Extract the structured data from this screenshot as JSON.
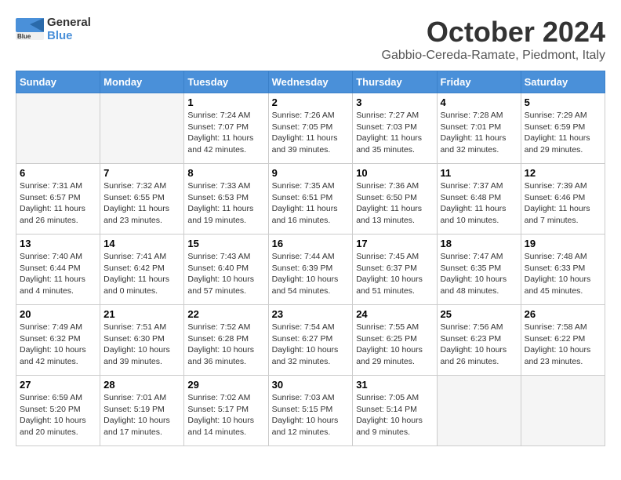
{
  "header": {
    "logo_general": "General",
    "logo_blue": "Blue",
    "month": "October 2024",
    "location": "Gabbio-Cereda-Ramate, Piedmont, Italy"
  },
  "weekdays": [
    "Sunday",
    "Monday",
    "Tuesday",
    "Wednesday",
    "Thursday",
    "Friday",
    "Saturday"
  ],
  "weeks": [
    [
      {
        "day": null
      },
      {
        "day": null
      },
      {
        "day": "1",
        "sunrise": "Sunrise: 7:24 AM",
        "sunset": "Sunset: 7:07 PM",
        "daylight": "Daylight: 11 hours and 42 minutes."
      },
      {
        "day": "2",
        "sunrise": "Sunrise: 7:26 AM",
        "sunset": "Sunset: 7:05 PM",
        "daylight": "Daylight: 11 hours and 39 minutes."
      },
      {
        "day": "3",
        "sunrise": "Sunrise: 7:27 AM",
        "sunset": "Sunset: 7:03 PM",
        "daylight": "Daylight: 11 hours and 35 minutes."
      },
      {
        "day": "4",
        "sunrise": "Sunrise: 7:28 AM",
        "sunset": "Sunset: 7:01 PM",
        "daylight": "Daylight: 11 hours and 32 minutes."
      },
      {
        "day": "5",
        "sunrise": "Sunrise: 7:29 AM",
        "sunset": "Sunset: 6:59 PM",
        "daylight": "Daylight: 11 hours and 29 minutes."
      }
    ],
    [
      {
        "day": "6",
        "sunrise": "Sunrise: 7:31 AM",
        "sunset": "Sunset: 6:57 PM",
        "daylight": "Daylight: 11 hours and 26 minutes."
      },
      {
        "day": "7",
        "sunrise": "Sunrise: 7:32 AM",
        "sunset": "Sunset: 6:55 PM",
        "daylight": "Daylight: 11 hours and 23 minutes."
      },
      {
        "day": "8",
        "sunrise": "Sunrise: 7:33 AM",
        "sunset": "Sunset: 6:53 PM",
        "daylight": "Daylight: 11 hours and 19 minutes."
      },
      {
        "day": "9",
        "sunrise": "Sunrise: 7:35 AM",
        "sunset": "Sunset: 6:51 PM",
        "daylight": "Daylight: 11 hours and 16 minutes."
      },
      {
        "day": "10",
        "sunrise": "Sunrise: 7:36 AM",
        "sunset": "Sunset: 6:50 PM",
        "daylight": "Daylight: 11 hours and 13 minutes."
      },
      {
        "day": "11",
        "sunrise": "Sunrise: 7:37 AM",
        "sunset": "Sunset: 6:48 PM",
        "daylight": "Daylight: 11 hours and 10 minutes."
      },
      {
        "day": "12",
        "sunrise": "Sunrise: 7:39 AM",
        "sunset": "Sunset: 6:46 PM",
        "daylight": "Daylight: 11 hours and 7 minutes."
      }
    ],
    [
      {
        "day": "13",
        "sunrise": "Sunrise: 7:40 AM",
        "sunset": "Sunset: 6:44 PM",
        "daylight": "Daylight: 11 hours and 4 minutes."
      },
      {
        "day": "14",
        "sunrise": "Sunrise: 7:41 AM",
        "sunset": "Sunset: 6:42 PM",
        "daylight": "Daylight: 11 hours and 0 minutes."
      },
      {
        "day": "15",
        "sunrise": "Sunrise: 7:43 AM",
        "sunset": "Sunset: 6:40 PM",
        "daylight": "Daylight: 10 hours and 57 minutes."
      },
      {
        "day": "16",
        "sunrise": "Sunrise: 7:44 AM",
        "sunset": "Sunset: 6:39 PM",
        "daylight": "Daylight: 10 hours and 54 minutes."
      },
      {
        "day": "17",
        "sunrise": "Sunrise: 7:45 AM",
        "sunset": "Sunset: 6:37 PM",
        "daylight": "Daylight: 10 hours and 51 minutes."
      },
      {
        "day": "18",
        "sunrise": "Sunrise: 7:47 AM",
        "sunset": "Sunset: 6:35 PM",
        "daylight": "Daylight: 10 hours and 48 minutes."
      },
      {
        "day": "19",
        "sunrise": "Sunrise: 7:48 AM",
        "sunset": "Sunset: 6:33 PM",
        "daylight": "Daylight: 10 hours and 45 minutes."
      }
    ],
    [
      {
        "day": "20",
        "sunrise": "Sunrise: 7:49 AM",
        "sunset": "Sunset: 6:32 PM",
        "daylight": "Daylight: 10 hours and 42 minutes."
      },
      {
        "day": "21",
        "sunrise": "Sunrise: 7:51 AM",
        "sunset": "Sunset: 6:30 PM",
        "daylight": "Daylight: 10 hours and 39 minutes."
      },
      {
        "day": "22",
        "sunrise": "Sunrise: 7:52 AM",
        "sunset": "Sunset: 6:28 PM",
        "daylight": "Daylight: 10 hours and 36 minutes."
      },
      {
        "day": "23",
        "sunrise": "Sunrise: 7:54 AM",
        "sunset": "Sunset: 6:27 PM",
        "daylight": "Daylight: 10 hours and 32 minutes."
      },
      {
        "day": "24",
        "sunrise": "Sunrise: 7:55 AM",
        "sunset": "Sunset: 6:25 PM",
        "daylight": "Daylight: 10 hours and 29 minutes."
      },
      {
        "day": "25",
        "sunrise": "Sunrise: 7:56 AM",
        "sunset": "Sunset: 6:23 PM",
        "daylight": "Daylight: 10 hours and 26 minutes."
      },
      {
        "day": "26",
        "sunrise": "Sunrise: 7:58 AM",
        "sunset": "Sunset: 6:22 PM",
        "daylight": "Daylight: 10 hours and 23 minutes."
      }
    ],
    [
      {
        "day": "27",
        "sunrise": "Sunrise: 6:59 AM",
        "sunset": "Sunset: 5:20 PM",
        "daylight": "Daylight: 10 hours and 20 minutes."
      },
      {
        "day": "28",
        "sunrise": "Sunrise: 7:01 AM",
        "sunset": "Sunset: 5:19 PM",
        "daylight": "Daylight: 10 hours and 17 minutes."
      },
      {
        "day": "29",
        "sunrise": "Sunrise: 7:02 AM",
        "sunset": "Sunset: 5:17 PM",
        "daylight": "Daylight: 10 hours and 14 minutes."
      },
      {
        "day": "30",
        "sunrise": "Sunrise: 7:03 AM",
        "sunset": "Sunset: 5:15 PM",
        "daylight": "Daylight: 10 hours and 12 minutes."
      },
      {
        "day": "31",
        "sunrise": "Sunrise: 7:05 AM",
        "sunset": "Sunset: 5:14 PM",
        "daylight": "Daylight: 10 hours and 9 minutes."
      },
      {
        "day": null
      },
      {
        "day": null
      }
    ]
  ]
}
